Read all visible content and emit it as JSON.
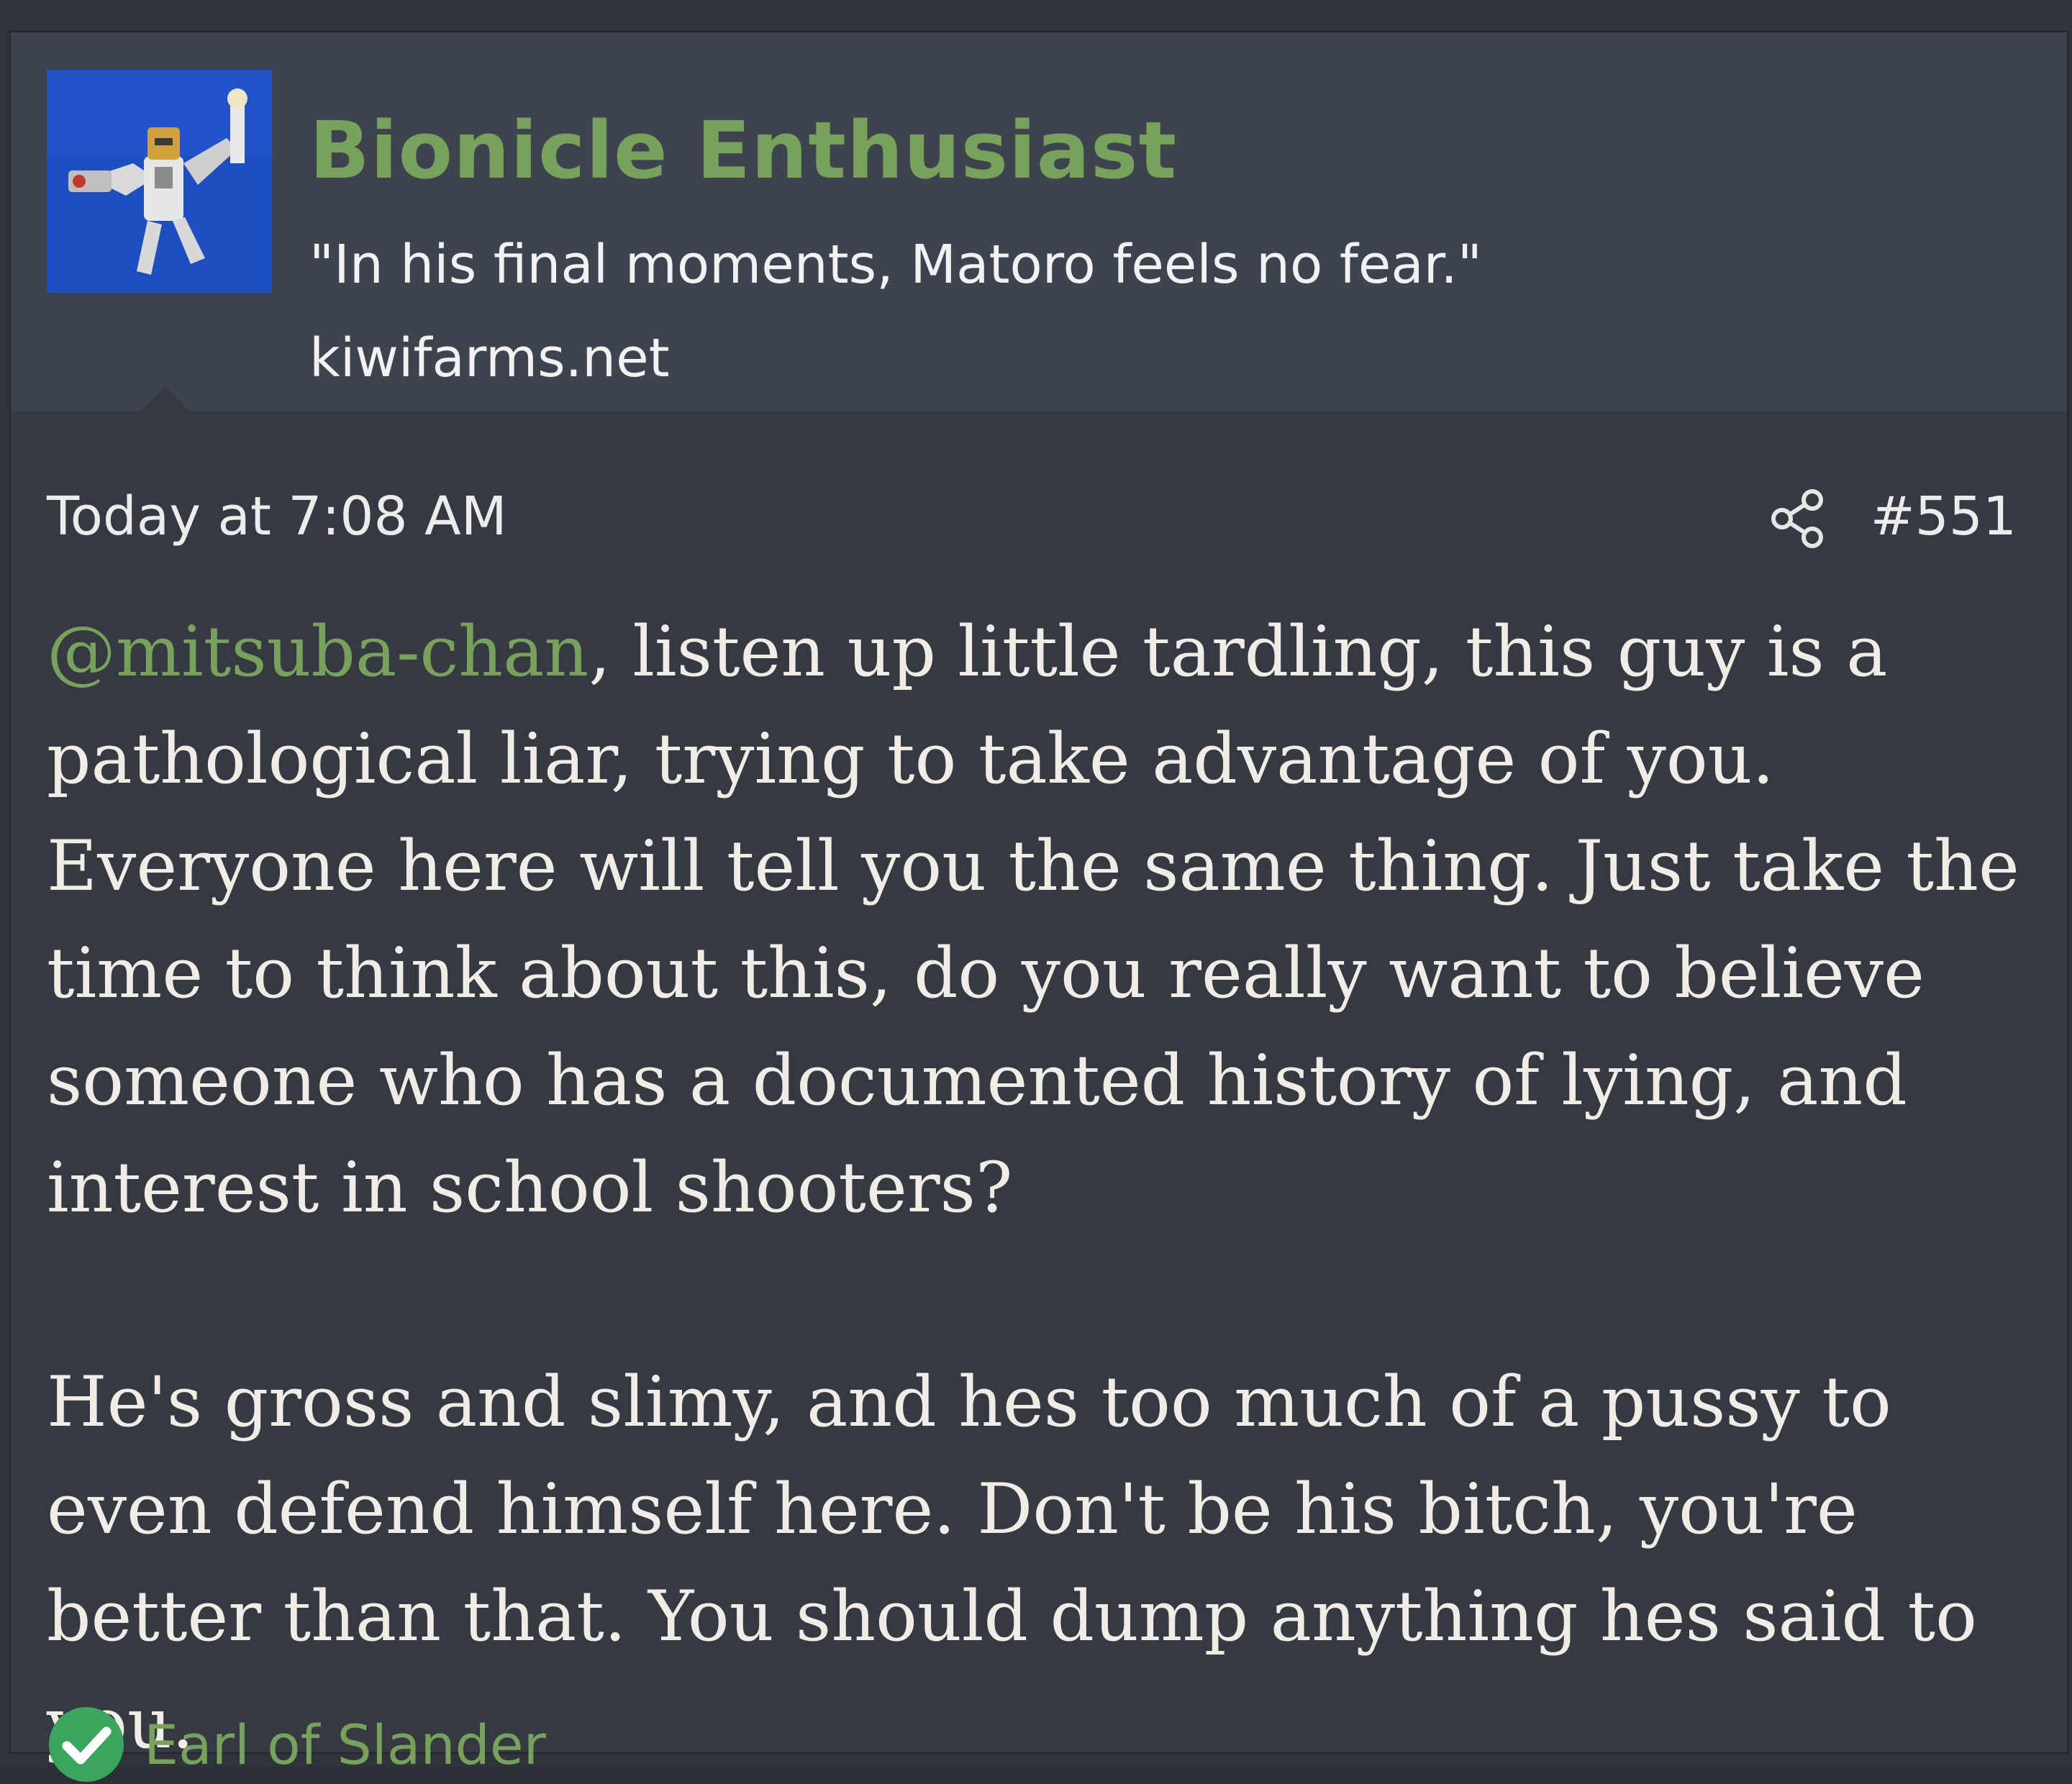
{
  "user": {
    "name": "Bionicle Enthusiast",
    "title": "\"In his final moments, Matoro feels no fear.\"",
    "site": "kiwifarms.net",
    "avatar_icon": "bionicle-figure-avatar"
  },
  "post": {
    "timestamp": "Today at 7:08 AM",
    "share_icon": "share-icon",
    "number": "#551",
    "mention": "@mitsuba-chan",
    "paragraph1_rest": ", listen up little tardling, this guy is a pathological liar, trying to take advantage of you. Everyone here will tell you the same thing. Just take the time to think about this, do you really want to believe someone who has a documented history of lying, and interest in school shooters?",
    "paragraph2": "He's gross and slimy, and hes too much of a pussy to even defend himself here. Don't be his bitch, you're better than that. You should dump anything hes said to you."
  },
  "reaction": {
    "icon": "check-circle-icon",
    "label": "Earl of Slander"
  },
  "colors": {
    "background": "#353a42",
    "header": "#3e444e",
    "accent_green": "#78a25c",
    "text": "#f1ede6",
    "check_green": "#3aa55c"
  }
}
